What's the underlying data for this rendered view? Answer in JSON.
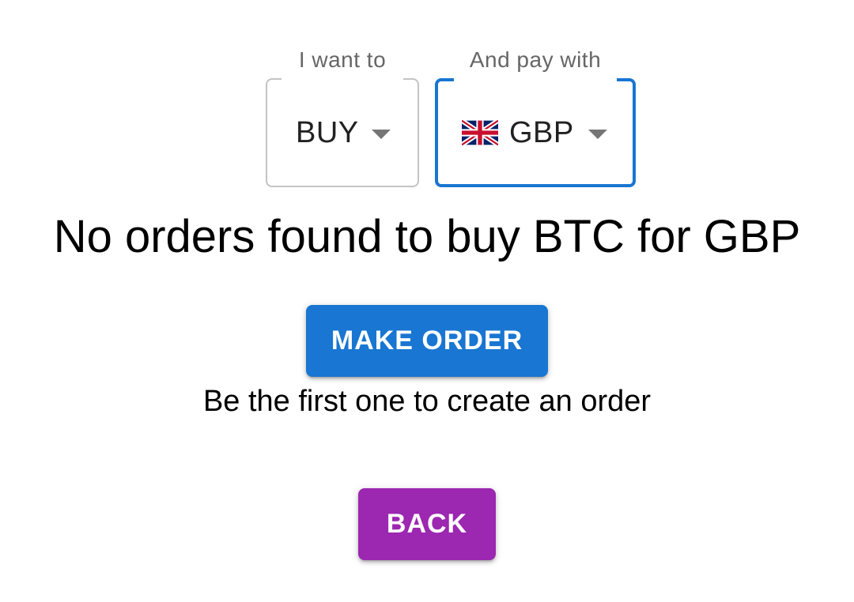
{
  "filters": {
    "type": {
      "legend": "I want to",
      "value": "BUY"
    },
    "currency": {
      "legend": "And pay with",
      "value": "GBP",
      "flag_icon": "uk-flag-icon"
    }
  },
  "message": {
    "heading": "No orders found to buy BTC for GBP",
    "subtext": "Be the first one to create an order"
  },
  "actions": {
    "make_order_label": "MAKE ORDER",
    "back_label": "BACK"
  },
  "colors": {
    "primary": "#1976d2",
    "secondary": "#9c27b0",
    "border": "#c4c4c4"
  }
}
